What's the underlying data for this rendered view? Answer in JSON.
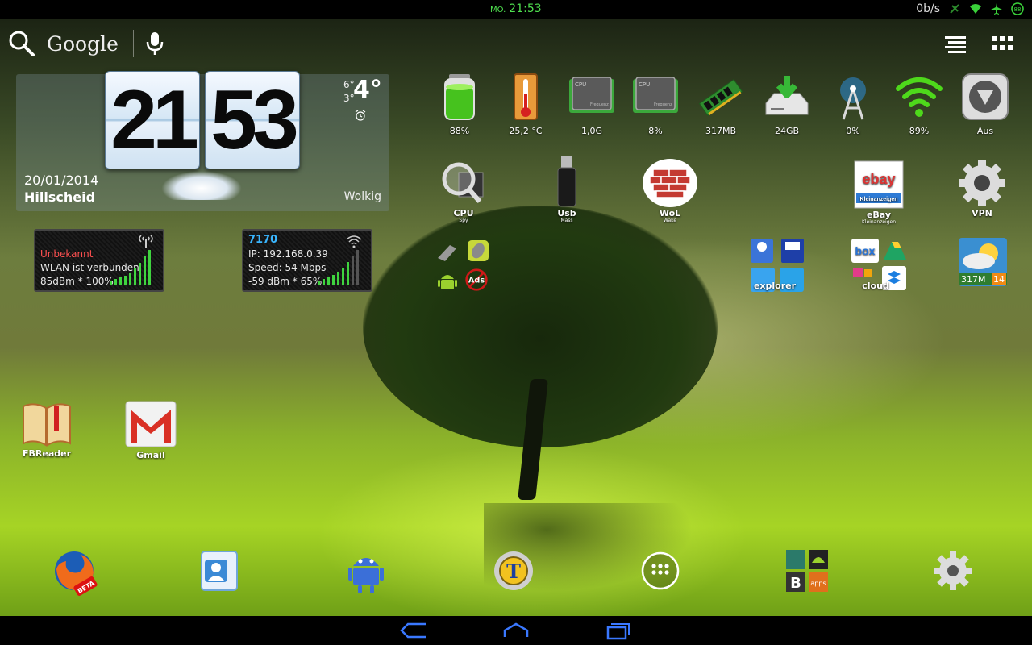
{
  "status_bar": {
    "day": "MO.",
    "time": "21:53",
    "net_speed": "0b/s",
    "icons": [
      "no-sync-icon",
      "wifi-icon",
      "airplane-icon",
      "battery-icon"
    ]
  },
  "search": {
    "label": "Google",
    "icons": [
      "search-icon",
      "mic-icon",
      "list-view-icon",
      "app-grid-icon"
    ]
  },
  "clock_widget": {
    "hours": "21",
    "minutes": "53",
    "date": "20/01/2014",
    "city": "Hillscheid",
    "condition": "Wolkig",
    "temp": "4°",
    "high": "6°",
    "low": "3°"
  },
  "wlan_widgets": [
    {
      "name": "Unbekannt",
      "line2": "WLAN ist verbunden",
      "line3": "85dBm * 100%"
    },
    {
      "name": "7170",
      "line2": "IP: 192.168.0.39",
      "line3": "Speed: 54 Mbps",
      "line4": "-59 dBm * 65%"
    }
  ],
  "system_icons": [
    {
      "icon": "battery-icon",
      "label": "88%"
    },
    {
      "icon": "thermometer-icon",
      "label": "25,2 °C"
    },
    {
      "icon": "cpu-freq-icon",
      "label": "1,0G",
      "chip": "CPU",
      "chip_sub": "Frequenz"
    },
    {
      "icon": "cpu-load-icon",
      "label": "8%",
      "chip": "CPU",
      "chip_sub": "Frequenz"
    },
    {
      "icon": "ram-icon",
      "label": "317MB"
    },
    {
      "icon": "storage-icon",
      "label": "24GB"
    },
    {
      "icon": "mobile-data-icon",
      "label": "0%"
    },
    {
      "icon": "wifi-signal-icon",
      "label": "89%"
    },
    {
      "icon": "auto-rotate-icon",
      "label": "Aus"
    }
  ],
  "apps": {
    "cpu_spy": {
      "label": "CPU",
      "sub": "Spy"
    },
    "usb_mass": {
      "label": "Usb",
      "sub": "Mass"
    },
    "wol": {
      "label": "WoL",
      "sub": "Wake",
      "icon": "brick-wall-icon"
    },
    "ebay": {
      "label": "eBay",
      "sub": "Kleinanzeigen",
      "logo": "ebay",
      "logo_sub": "Kleinanzeigen"
    },
    "vpn": {
      "label": "VPN"
    },
    "explorer_folder": {
      "label": "explorer"
    },
    "cloud_folder": {
      "label": "cloud",
      "box_text": "box"
    },
    "weather_app": {
      "left": "317M",
      "right": "14"
    },
    "fbreader": {
      "label": "FBReader"
    },
    "gmail": {
      "label": "Gmail"
    },
    "ads_badge": "Ads"
  },
  "dock": [
    {
      "icon": "firefox-beta-icon",
      "badge": "BETA"
    },
    {
      "icon": "contacts-icon"
    },
    {
      "icon": "android-tool-icon"
    },
    {
      "icon": "titanium-backup-icon",
      "letter": "T"
    },
    {
      "icon": "app-drawer-icon"
    },
    {
      "icon": "apps-folder-icon",
      "letter": "B",
      "sub": "apps"
    },
    {
      "icon": "settings-icon"
    }
  ],
  "nav": [
    "back-icon",
    "home-icon",
    "recents-icon"
  ],
  "colors": {
    "status_clock": "#4fe04f",
    "nav_icon": "#3a78ff",
    "wlan_name_blue": "#39b6ff",
    "wlan_name_red": "#ff5050"
  }
}
